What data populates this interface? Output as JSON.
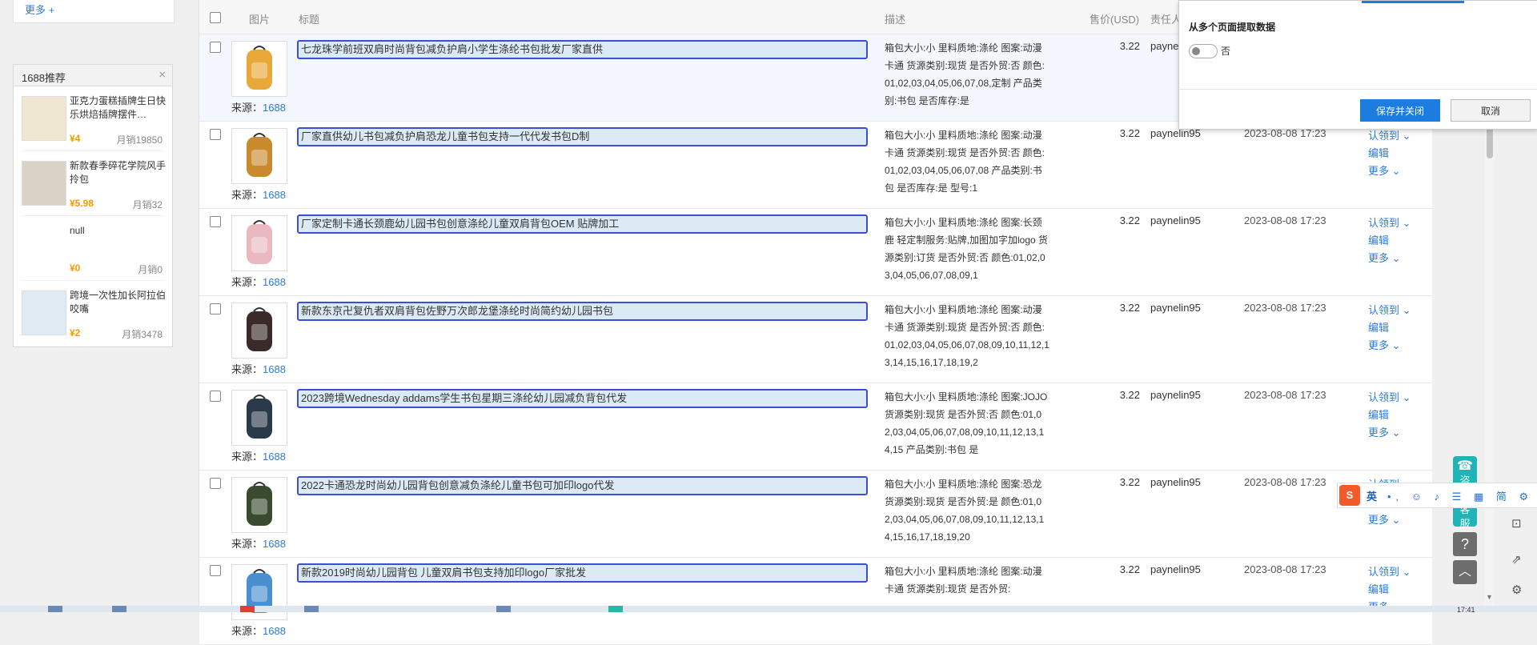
{
  "left": {
    "more_link": "更多 +",
    "rec_title": "1688推荐",
    "rec_close": "×",
    "items": [
      {
        "title": "亚克力蛋糕插牌生日快乐烘焙插牌摆件…",
        "price": "¥4",
        "sales": "月销19850"
      },
      {
        "title": "新款春季碎花学院风手拎包",
        "price": "¥5.98",
        "sales": "月销32"
      },
      {
        "title": "null",
        "price": "¥0",
        "sales": "月销0"
      },
      {
        "title": "跨境一次性加长阿拉伯咬嘴",
        "price": "¥2",
        "sales": "月销3478"
      }
    ]
  },
  "table": {
    "headers": {
      "image": "图片",
      "title": "标题",
      "desc": "描述",
      "price": "售价(USD)",
      "owner": "责任人"
    },
    "source_label": "来源：",
    "source_value": "1688",
    "actions": {
      "claim": "认领到 ⌄",
      "edit": "编辑",
      "more": "更多 ⌄"
    },
    "rows": [
      {
        "title": "七龙珠学前班双肩时尚背包减负护肩小学生涤纶书包批发厂家直供",
        "desc": "箱包大小:小 里料质地:涤纶 图案:动漫卡通 货源类别:现货 是否外贸:否 颜色:01,02,03,04,05,06,07,08,定制 产品类别:书包 是否库存:是",
        "price": "3.22",
        "owner": "paynelin95",
        "date": "2023-08-08 17:23",
        "thumb_color": "#e8a83a"
      },
      {
        "title": "厂家直供幼儿书包减负护肩恐龙儿童书包支持一代代发书包D制",
        "desc": "箱包大小:小 里料质地:涤纶 图案:动漫卡通 货源类别:现货 是否外贸:否 颜色:01,02,03,04,05,06,07,08 产品类别:书包 是否库存:是 型号:1",
        "price": "3.22",
        "owner": "paynelin95",
        "date": "2023-08-08 17:23",
        "thumb_color": "#c98a2e"
      },
      {
        "title": "厂家定制卡通长颈鹿幼儿园书包创意涤纶儿童双肩背包OEM 贴牌加工",
        "desc": "箱包大小:小 里料质地:涤纶 图案:长颈鹿 轻定制服务:贴牌,加图加字加logo 货源类别:订货 是否外贸:否 颜色:01,02,03,04,05,06,07,08,09,1",
        "price": "3.22",
        "owner": "paynelin95",
        "date": "2023-08-08 17:23",
        "thumb_color": "#e9b8c0"
      },
      {
        "title": "新款东京卍复仇者双肩背包佐野万次郎龙堡涤纶时尚简约幼儿园书包",
        "desc": "箱包大小:小 里料质地:涤纶 图案:动漫卡通 货源类别:现货 是否外贸:否 颜色:01,02,03,04,05,06,07,08,09,10,11,12,13,14,15,16,17,18,19,2",
        "price": "3.22",
        "owner": "paynelin95",
        "date": "2023-08-08 17:23",
        "thumb_color": "#3a2a2a"
      },
      {
        "title": "2023跨境Wednesday addams学生书包星期三涤纶幼儿园减负背包代发",
        "desc": "箱包大小:小 里料质地:涤纶 图案:JOJO 货源类别:现货 是否外贸:否 颜色:01,02,03,04,05,06,07,08,09,10,11,12,13,14,15 产品类别:书包 是",
        "price": "3.22",
        "owner": "paynelin95",
        "date": "2023-08-08 17:23",
        "thumb_color": "#2b3a4a"
      },
      {
        "title": "2022卡通恐龙时尚幼儿园背包创意减负涤纶儿童书包可加印logo代发",
        "desc": "箱包大小:小 里料质地:涤纶 图案:恐龙 货源类别:现货 是否外贸:是 颜色:01,02,03,04,05,06,07,08,09,10,11,12,13,14,15,16,17,18,19,20",
        "price": "3.22",
        "owner": "paynelin95",
        "date": "2023-08-08 17:23",
        "thumb_color": "#3a4a2e"
      },
      {
        "title": "新款2019时尚幼儿园背包 儿童双肩书包支持加印logo厂家批发",
        "desc": "箱包大小:小 里料质地:涤纶 图案:动漫卡通 货源类别:现货 是否外贸:",
        "price": "3.22",
        "owner": "paynelin95",
        "date": "2023-08-08 17:23",
        "thumb_color": "#4a8fd0"
      }
    ]
  },
  "popup": {
    "label": "从多个页面提取数据",
    "toggle_text": "否",
    "save": "保存并关闭",
    "cancel": "取消"
  },
  "float": {
    "chat": "咨询客服",
    "help": "?",
    "top": "︿"
  },
  "ime": {
    "logo": "S",
    "lang": "英",
    "icons": "•, ☺ ♪ ☰ ▦ 简 ⚙"
  },
  "clock": "17:41"
}
